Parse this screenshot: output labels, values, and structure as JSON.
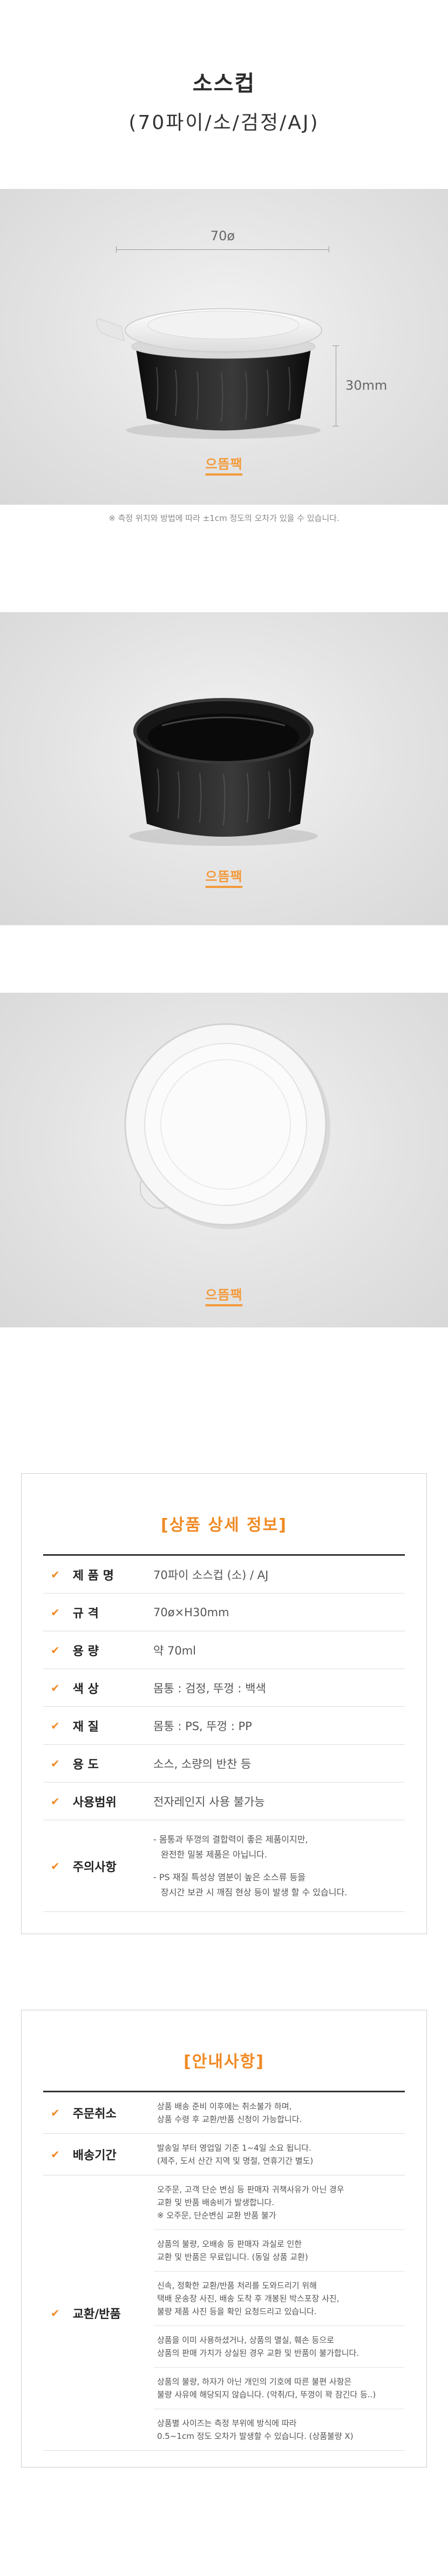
{
  "header": {
    "title": "소스컵",
    "subtitle": "(70파이/소/검정/AJ)"
  },
  "photo1": {
    "dim_width": "70ø",
    "dim_height": "30mm",
    "logo": "으뜸팩",
    "note": "※ 측정 위치와 방법에 따라 ±1cm 정도의 오차가 있을 수 있습니다."
  },
  "photo2": {
    "logo": "으뜸팩"
  },
  "photo3": {
    "logo": "으뜸팩"
  },
  "colors": {
    "accent": "#f08a24",
    "logo": "#f39a3a",
    "cup_body": "#1a1a1a"
  },
  "spec": {
    "title": "[상품 상세 정보]",
    "rows": [
      {
        "key": "제 품 명",
        "value": "70파이 소스컵 (소) / AJ"
      },
      {
        "key": "규    격",
        "value": "70ø×H30mm"
      },
      {
        "key": "용    량",
        "value": "약 70ml"
      },
      {
        "key": "색    상",
        "value": "몸통 : 검정, 뚜껑 : 백색"
      },
      {
        "key": "재    질",
        "value": "몸통 : PS, 뚜껑 : PP"
      },
      {
        "key": "용    도",
        "value": "소스, 소량의 반찬 등"
      },
      {
        "key": "사용범위",
        "value": "전자레인지 사용 불가능"
      }
    ],
    "caution": {
      "key": "주의사항",
      "lines": [
        "- 몸통과 뚜껑의 결합력이 좋은 제품이지만,",
        "완전한 밀봉 제품은 아닙니다.",
        "- PS 재질 특성상 염분이 높은 소스류 등을",
        "장시간 보관 시 깨짐 현상 등이 발생 할 수 있습니다."
      ]
    }
  },
  "guide": {
    "title": "[안내사항]",
    "cancel": {
      "key": "주문취소",
      "text": [
        "상품 배송 준비 이후에는 취소불가 하며,",
        "상품 수령 후 교환/반품 신청이 가능합니다."
      ]
    },
    "shipping": {
      "key": "배송기간",
      "text": [
        "발송일 부터 영업일 기준 1~4일 소요 됩니다.",
        "(제주, 도서 산간 지역 및 명절, 연휴기간 별도)"
      ]
    },
    "return": {
      "key": "교환/반품",
      "cells": [
        [
          "오주문, 고객 단순 변심 등 판매자 귀책사유가 아닌 경우",
          "교환 및 반품 배송비가 발생합니다.",
          "※ 오주문, 단순변심 교환 반품 불가"
        ],
        [
          "상품의 불량, 오배송 등 판매자 과실로 인한",
          "교환 및 반품은 무료입니다. (동일 상품 교환)"
        ],
        [
          "신속, 정확한 교환/반품 처리를 도와드리기 위해",
          "택배 운송장 사진, 배송 도착 후 개봉된 박스포장 사진,",
          "불량 제품 사진 등을 확인 요청드리고 있습니다."
        ],
        [
          "상품을 이미 사용하셨거나, 상품의 멸실, 훼손 등으로",
          "상품의 판매 가치가 상실된 경우 교환 및 반품이 불가합니다."
        ],
        [
          "상품의 불량, 하자가 아닌 개인의 기호에 따른 불편 사항은",
          "불량 사유에 해당되지 않습니다. (악취/다, 뚜껑이 꽉 잠긴다 등..)"
        ],
        [
          "상품별 사이즈는 측정 부위에 방식에 따라",
          "0.5~1cm 정도 오차가 발생할 수 있습니다. (상품불량 X)"
        ]
      ]
    }
  }
}
